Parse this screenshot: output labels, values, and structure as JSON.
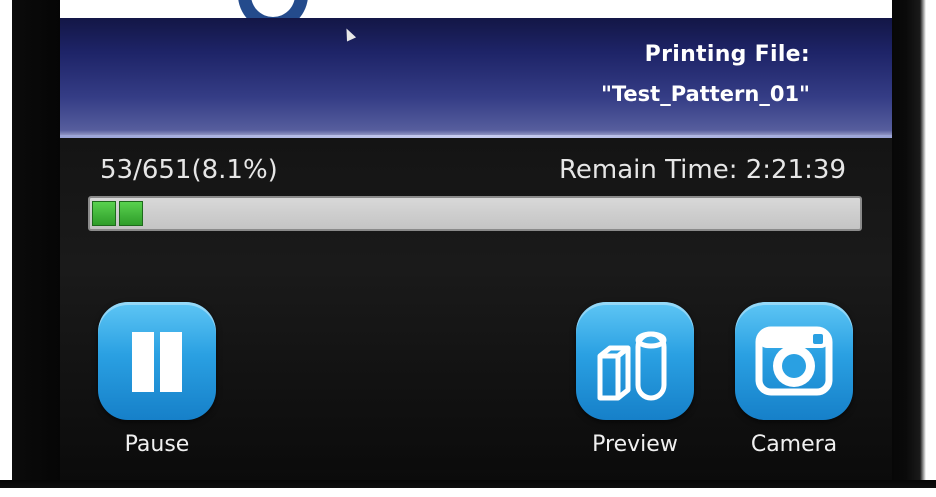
{
  "header": {
    "title": "Printing File:",
    "file_name": "\"Test_Pattern_01\""
  },
  "progress": {
    "layers_text": "53/651(8.1%)",
    "layers_done": 53,
    "layers_total": 651,
    "percent": 8.1,
    "remain_time": "Remain Time: 2:21:39"
  },
  "buttons": {
    "pause": {
      "label": "Pause",
      "icon": "pause-icon"
    },
    "preview": {
      "label": "Preview",
      "icon": "preview-icon"
    },
    "camera": {
      "label": "Camera",
      "icon": "camera-icon"
    }
  },
  "colors": {
    "header_top": "#131646",
    "header_bottom": "#8f93c2",
    "button_blue": "#2aa0e2",
    "progress_green": "#3fb037",
    "screen_bg": "#141414"
  }
}
